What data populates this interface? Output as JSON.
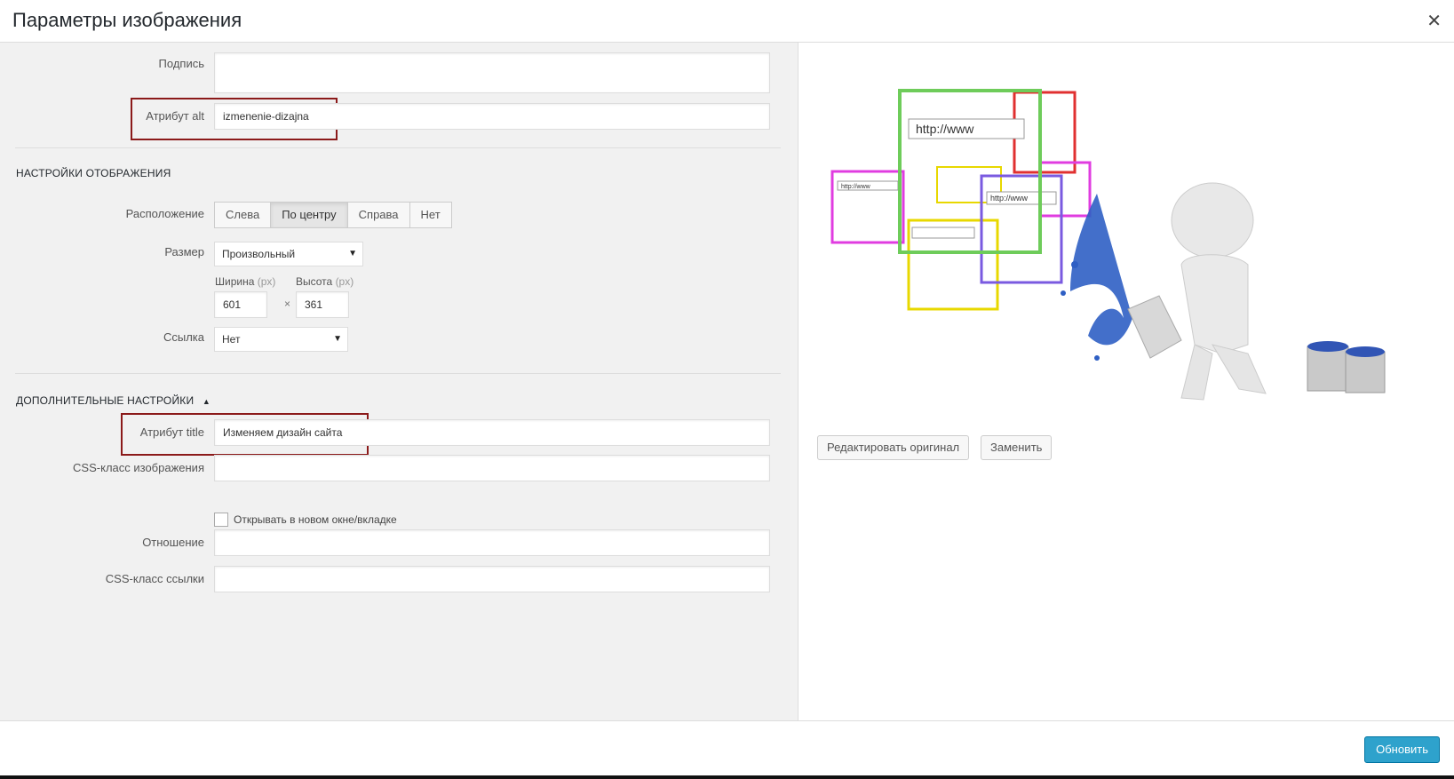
{
  "dialog": {
    "title": "Параметры изображения"
  },
  "fields": {
    "caption_label": "Подпись",
    "caption_value": "",
    "alt_label": "Атрибут alt",
    "alt_value": "izmenenie-dizajna"
  },
  "display": {
    "section_title": "НАСТРОЙКИ ОТОБРАЖЕНИЯ",
    "align_label": "Расположение",
    "align_options": [
      "Слева",
      "По центру",
      "Справа",
      "Нет"
    ],
    "align_selected": "По центру",
    "size_label": "Размер",
    "size_value": "Произвольный",
    "width_label": "Ширина",
    "height_label": "Высота",
    "unit": "(px)",
    "width_value": "601",
    "height_value": "361",
    "times": "×",
    "link_label": "Ссылка",
    "link_value": "Нет"
  },
  "advanced": {
    "section_title": "ДОПОЛНИТЕЛЬНЫЕ НАСТРОЙКИ",
    "title_label": "Атрибут title",
    "title_value": "Изменяем дизайн сайта",
    "css_image_label": "CSS-класс изображения",
    "css_image_value": "",
    "new_window_label": "Открывать в новом окне/вкладке",
    "new_window_checked": false,
    "rel_label": "Отношение",
    "rel_value": "",
    "css_link_label": "CSS-класс ссылки",
    "css_link_value": ""
  },
  "preview": {
    "browser_text": "http://www",
    "edit_original": "Редактировать оригинал",
    "replace": "Заменить"
  },
  "footer": {
    "update": "Обновить"
  },
  "colors": {
    "accent": "#2ea2cc",
    "highlight": "#8b1a1a"
  }
}
